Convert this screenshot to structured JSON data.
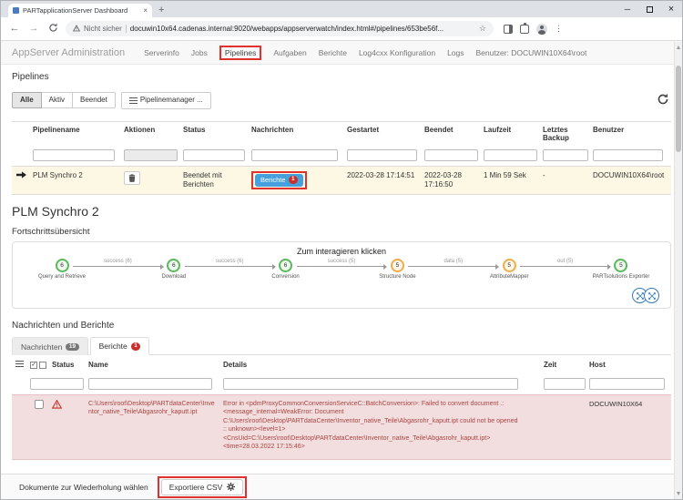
{
  "browser": {
    "tab_title": "PARTapplicationServer Dashboard",
    "security_label": "Nicht sicher",
    "url": "docuwin10x64.cadenas.internal:9020/webapps/appserverwatch/index.html#/pipelines/653be56f..."
  },
  "icons": {
    "back": "←",
    "forward": "→",
    "star": "☆",
    "kebab": "⋮",
    "close": "×",
    "minimize": "─",
    "new_tab": "+",
    "check": "✓"
  },
  "nav": {
    "brand": "AppServer Administration",
    "items": [
      "Serverinfo",
      "Jobs",
      "Pipelines",
      "Aufgaben",
      "Berichte",
      "Log4cxx Konfiguration",
      "Logs"
    ],
    "user": "Benutzer: DOCUWIN10X64\\root"
  },
  "pipelines": {
    "title": "Pipelines",
    "filter_all": "Alle",
    "filter_active": "Aktiv",
    "filter_finished": "Beendet",
    "manager_button": "Pipelinemanager ...",
    "headers": [
      "Pipelinename",
      "Aktionen",
      "Status",
      "Nachrichten",
      "Gestartet",
      "Beendet",
      "Laufzeit",
      "Letztes Backup",
      "Benutzer"
    ],
    "row": {
      "name": "PLM Synchro 2",
      "status": "Beendet mit Berichten",
      "messages_button": "Berichte",
      "messages_count": "1",
      "started": "2022-03-28 17:14:51",
      "ended": "2022-03-28 17:16:50",
      "runtime": "1 Min 59 Sek",
      "backup": "-",
      "user": "DOCUWIN10X64\\root"
    }
  },
  "detail": {
    "title": "PLM Synchro 2",
    "subtitle": "Fortschrittsübersicht",
    "hint": "Zum interagieren klicken",
    "nodes": [
      {
        "label": "Query and Retrieve",
        "count": "6"
      },
      {
        "label": "Download",
        "count": "6"
      },
      {
        "label": "Conversion",
        "count": "6"
      },
      {
        "label": "Structure Node",
        "count": "5"
      },
      {
        "label": "AttributeMapper",
        "count": "5"
      },
      {
        "label": "PARTsolutions Exporter",
        "count": "5"
      }
    ],
    "edges": [
      "success (6)",
      "success (6)",
      "success (5)",
      "data (5)",
      "out (5)"
    ]
  },
  "messages": {
    "title": "Nachrichten und Berichte",
    "tab_messages": "Nachrichten",
    "tab_messages_count": "19",
    "tab_reports": "Berichte",
    "tab_reports_count": "1",
    "headers": [
      "Status",
      "Name",
      "Details",
      "Zeit",
      "Host"
    ],
    "row": {
      "name": "C:\\Users\\root\\Desktop\\PARTdataCenter\\Inventor_native_Teile\\Abgasrohr_kaputt.ipt",
      "details": "Error in <pdmProxyCommonConversionServiceC::BatchConversion>: Failed to convert document .:\n<message_internal=WeakError: Document\nC:\\Users\\root\\Desktop\\PARTdataCenter\\Inventor_native_Teile\\Abgasrohr_kaputt.ipt could not be opened\n:: unknown><level=1>\n<CnsUid=C:\\Users\\root\\Desktop\\PARTdataCenter\\Inventor_native_Teile\\Abgasrohr_kaputt.ipt>\n<time=28.03.2022 17:15:46>",
      "host": "DOCUWIN10X64"
    }
  },
  "footer": {
    "select_label": "Dokumente zur Wiederholung wählen",
    "export_label": "Exportiere CSV"
  },
  "colors": {
    "annotation": "#e0312d",
    "node_success": "#5cb85c",
    "node_warning": "#f0ad4e",
    "primary_blue": "#46a0dc",
    "error_bg": "#f2dede",
    "row_highlight": "#fcf8e3"
  }
}
